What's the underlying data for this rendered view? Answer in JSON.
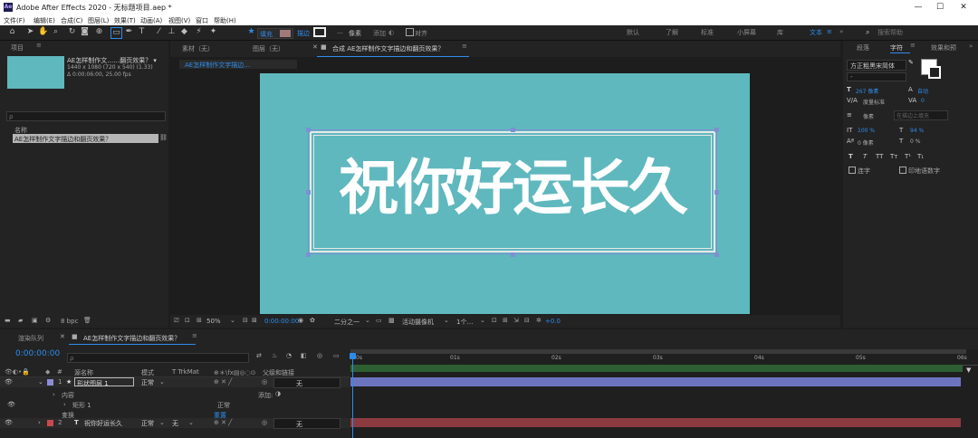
{
  "app": {
    "title": "Adobe After Effects 2020 - 无标题项目.aep *",
    "logo": "Ae"
  },
  "window_buttons": [
    "—",
    "☐",
    "✕"
  ],
  "menu": [
    "文件(F)",
    "编辑(E)",
    "合成(C)",
    "图层(L)",
    "效果(T)",
    "动画(A)",
    "视图(V)",
    "窗口",
    "帮助(H)"
  ],
  "toolbar": {
    "fill_label": "填充",
    "stroke_label": "描边",
    "stroke_width": "像素",
    "add_label": "添加",
    "snap_label": "对齐",
    "workspaces": [
      "默认",
      "了解",
      "标准",
      "小屏幕",
      "库",
      "文本"
    ],
    "search_placeholder": "搜索帮助"
  },
  "project": {
    "tab": "项目",
    "item_title": "AE怎样制作文……翻页效果？ ▾",
    "item_size": "1440 x 1080 (720 x 540) (1.33)",
    "item_duration": "Δ 0:00:06:00, 25.00 fps",
    "search_placeholder": "ρ",
    "col_name": "名称",
    "row_name": "AE怎样制作文字描边和翻页效果？",
    "footer_bpc": "8 bpc"
  },
  "viewer": {
    "tabs": [
      "素材（无）",
      "图层（无）",
      "合成 AE怎样制作文字描边和翻页效果？"
    ],
    "breadcrumb": "AE怎样制作文字描边…",
    "text": "祝你好运长久",
    "canvas_color": "#5fb8be",
    "zoom": "50%",
    "timecode": "0:00:00:00",
    "resolution": "二分之一",
    "camera": "活动摄像机",
    "views": "1个…",
    "exposure": "+0.0"
  },
  "right_panel": {
    "tabs": [
      "段落",
      "字符",
      "效果和预"
    ],
    "font": "方正粗黑宋简体",
    "font_style": "-",
    "size": "267 像素",
    "leading": "自动",
    "tracking": "0",
    "kerning": "度量标准",
    "stroke": "像素",
    "stroke_mode": "在描边上填充",
    "vscale": "100 %",
    "hscale": "94 %",
    "baseline": "0 像素",
    "tsume": "0 %",
    "ligature": "连字",
    "hindi": "印地语数字",
    "style_buttons": [
      "T",
      "T",
      "TT",
      "Tт",
      "T¹",
      "T₁"
    ]
  },
  "timeline": {
    "tabs": [
      "渲染队列",
      "AE怎样制作文字描边和翻页效果？"
    ],
    "timecode": "0:00:00:00",
    "search_placeholder": "ρ",
    "columns": {
      "name": "源名称",
      "mode": "模式",
      "trkmat": "TrkMat",
      "parent": "父级和链接"
    },
    "ruler": [
      "0s",
      "01s",
      "02s",
      "03s",
      "04s",
      "05s",
      "06s"
    ],
    "layers": [
      {
        "num": "1",
        "name": "形状图层 1",
        "mode": "正常",
        "parent": "无",
        "color": "#8c8cd6",
        "bar_color": "#6d74bf"
      },
      {
        "num": "2",
        "name": "祝你好运长久",
        "mode": "正常",
        "trkmat": "无",
        "parent": "无",
        "color": "#c9484d",
        "bar_color": "#8b3b40"
      }
    ],
    "sublayer_contents": "内容",
    "sublayer_add": "添加:",
    "sublayer_rect": "矩形 1",
    "sublayer_rect_mode": "正常",
    "sublayer_transform": "变换",
    "sublayer_reset": "重置"
  }
}
